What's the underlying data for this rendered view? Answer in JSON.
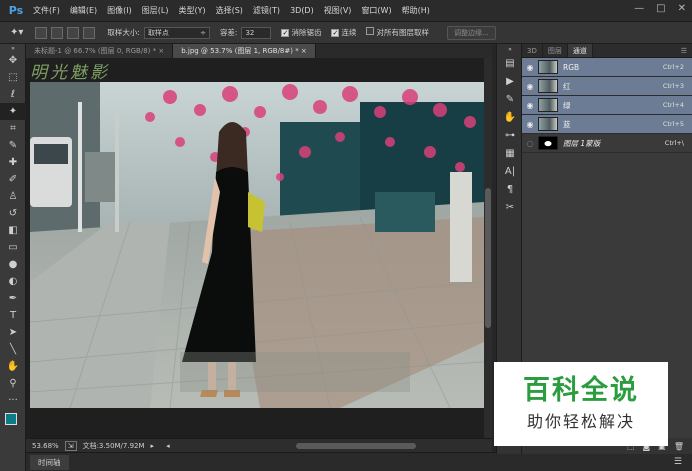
{
  "app": {
    "logo": "Ps"
  },
  "menu": [
    "文件(F)",
    "编辑(E)",
    "图像(I)",
    "图层(L)",
    "类型(Y)",
    "选择(S)",
    "滤镜(T)",
    "3D(D)",
    "视图(V)",
    "窗口(W)",
    "帮助(H)"
  ],
  "window_controls": [
    "—",
    "□",
    "✕"
  ],
  "options": {
    "sample_size_label": "取样大小:",
    "sample_size_value": "取样点",
    "tolerance_label": "容差:",
    "tolerance_value": "32",
    "antialias_label": "消除锯齿",
    "contiguous_label": "连续",
    "all_layers_label": "对所有图层取样",
    "refine_edge_label": "调整边缘..."
  },
  "tabs": [
    {
      "label": "未标题-1 @ 66.7% (图层 0, RGB/8) * ×",
      "active": false
    },
    {
      "label": "b.jpg @ 53.7% (图层 1, RGB/8#) * ×",
      "active": true
    }
  ],
  "canvas": {
    "overlay_text": "明光魅影"
  },
  "status": {
    "zoom": "53.68%",
    "doc_info": "文档:3.50M/7.92M"
  },
  "timeline": {
    "label": "时间轴"
  },
  "panel": {
    "tabs": [
      {
        "label": "3D",
        "active": false
      },
      {
        "label": "图层",
        "active": false
      },
      {
        "label": "通道",
        "active": true
      }
    ],
    "channels": [
      {
        "name": "RGB",
        "shortcut": "Ctrl+2",
        "selected": true
      },
      {
        "name": "红",
        "shortcut": "Ctrl+3",
        "selected": true
      },
      {
        "name": "绿",
        "shortcut": "Ctrl+4",
        "selected": true
      },
      {
        "name": "蓝",
        "shortcut": "Ctrl+5",
        "selected": true
      },
      {
        "name": "图层 1蒙版",
        "shortcut": "Ctrl+\\",
        "selected": false
      }
    ]
  },
  "brand": {
    "title": "百科全说",
    "subtitle": "助你轻松解决"
  },
  "colors": {
    "accent": "#2b9c3f",
    "selection": "#6c7c94",
    "ps_blue": "#4aa3e6"
  }
}
